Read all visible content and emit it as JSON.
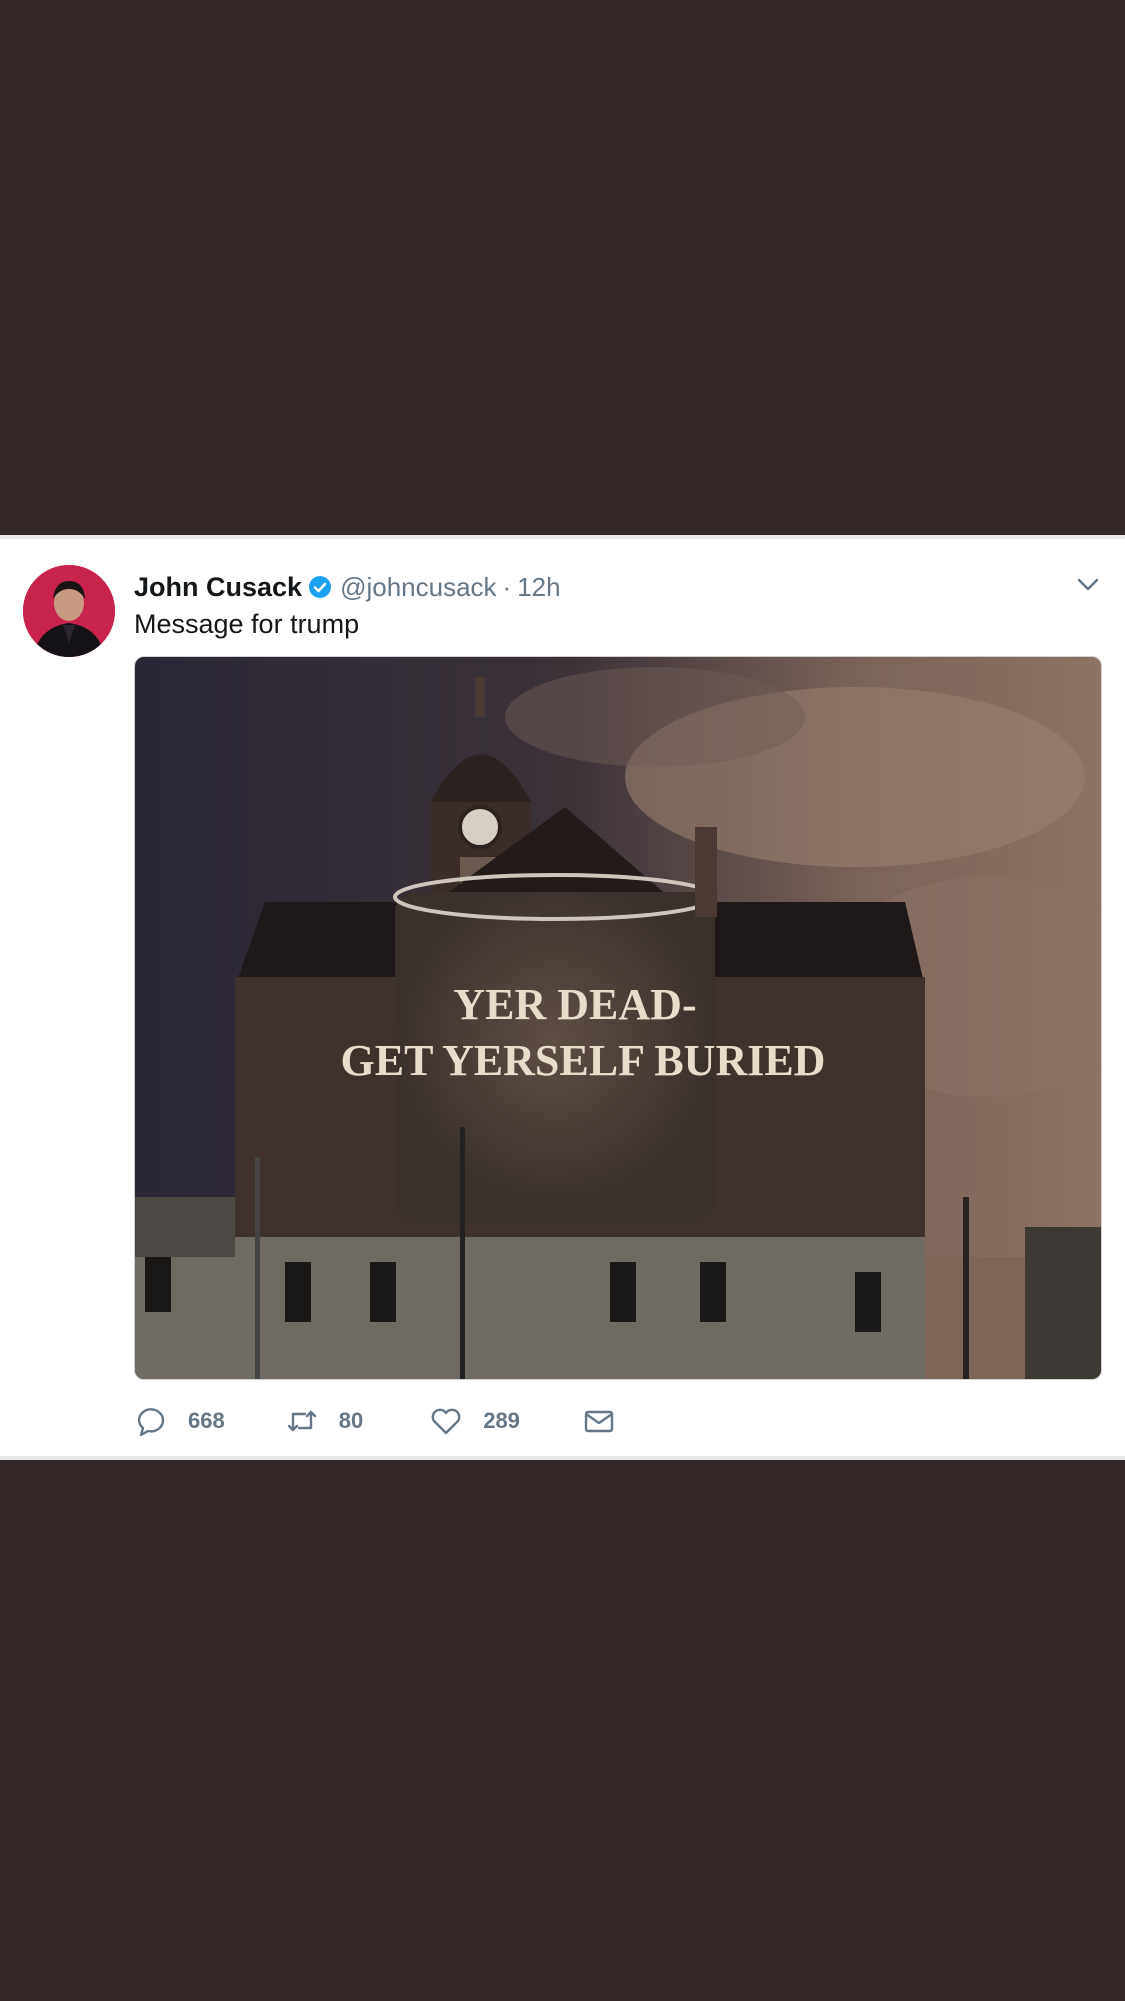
{
  "tweet": {
    "author_name": "John Cusack",
    "handle": "@johncusack",
    "separator": "·",
    "time": "12h",
    "text": "Message for trump",
    "image_text_line1": "YER DEAD-",
    "image_text_line2": "GET YERSELF BURIED",
    "replies": "668",
    "retweets": "80",
    "likes": "289"
  },
  "icons": {
    "verified": "verified-badge-icon",
    "caret": "chevron-down-icon",
    "reply": "reply-icon",
    "retweet": "retweet-icon",
    "like": "heart-icon",
    "dm": "envelope-icon"
  },
  "colors": {
    "background": "#332827",
    "card": "#ffffff",
    "name": "#14171a",
    "secondary": "#657786",
    "verified": "#1da1f2"
  }
}
